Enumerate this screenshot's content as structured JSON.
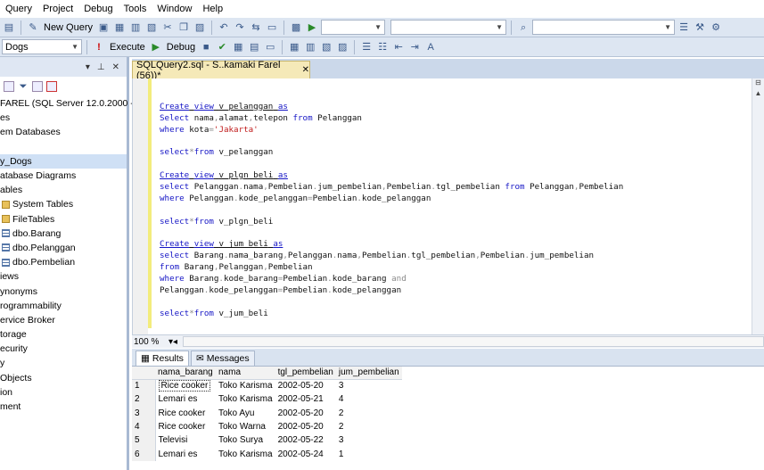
{
  "menu": [
    "Query",
    "Project",
    "Debug",
    "Tools",
    "Window",
    "Help"
  ],
  "toolbar1": {
    "new_query": "New Query"
  },
  "toolbar2": {
    "database": "Dogs",
    "execute": "Execute",
    "debug": "Debug"
  },
  "object_explorer": {
    "header_controls": [
      "▾",
      "📌",
      "✕"
    ],
    "items": [
      {
        "label": "FAREL (SQL Server 12.0.2000 -",
        "icon": "server-icon"
      },
      {
        "label": "es",
        "icon": ""
      },
      {
        "label": "em Databases",
        "icon": ""
      },
      {
        "label": "",
        "icon": ""
      },
      {
        "label": "y_Dogs",
        "icon": "",
        "selected": true
      },
      {
        "label": "atabase Diagrams",
        "icon": ""
      },
      {
        "label": "ables",
        "icon": ""
      },
      {
        "label": "System Tables",
        "icon": "folder-icon"
      },
      {
        "label": "FileTables",
        "icon": "folder-icon"
      },
      {
        "label": "dbo.Barang",
        "icon": "table-icon"
      },
      {
        "label": "dbo.Pelanggan",
        "icon": "table-icon"
      },
      {
        "label": "dbo.Pembelian",
        "icon": "table-icon"
      },
      {
        "label": "iews",
        "icon": ""
      },
      {
        "label": "ynonyms",
        "icon": ""
      },
      {
        "label": "rogrammability",
        "icon": ""
      },
      {
        "label": "ervice Broker",
        "icon": ""
      },
      {
        "label": "torage",
        "icon": ""
      },
      {
        "label": "ecurity",
        "icon": ""
      },
      {
        "label": "y",
        "icon": ""
      },
      {
        "label": "Objects",
        "icon": ""
      },
      {
        "label": "ion",
        "icon": ""
      },
      {
        "label": "ment",
        "icon": ""
      }
    ]
  },
  "tab": {
    "title": "SQLQuery2.sql - S..kamaki Farel (56))*",
    "close": "✕"
  },
  "code_lines": [
    "",
    "",
    "Create view v_pelanggan as",
    "Select nama,alamat,telepon from Pelanggan",
    "where kota='Jakarta'",
    "",
    "select*from v_pelanggan",
    "",
    "Create view v_plgn_beli as",
    "select Pelanggan.nama,Pembelian.jum_pembelian,Pembelian.tgl_pembelian from Pelanggan,Pembelian",
    "where Pelanggan.kode_pelanggan=Pembelian.kode_pelanggan",
    "",
    "select*from v_plgn_beli",
    "",
    "Create view v_jum_beli as",
    "select Barang.nama_barang,Pelanggan.nama,Pembelian.tgl_pembelian,Pembelian.jum_pembelian",
    "from Barang,Pelanggan,Pembelian",
    "where Barang.kode_barang=Pembelian.kode_barang and",
    "Pelanggan.kode_pelanggan=Pembelian.kode_pelanggan",
    "",
    "select*from v_jum_beli"
  ],
  "zoom": "100 %",
  "results_tabs": {
    "results": "Results",
    "messages": "Messages"
  },
  "results": {
    "columns": [
      "nama_barang",
      "nama",
      "tgl_pembelian",
      "jum_pembelian"
    ],
    "rows": [
      [
        "1",
        "Rice cooker",
        "Toko Karisma",
        "2002-05-20",
        "3"
      ],
      [
        "2",
        "Lemari es",
        "Toko Karisma",
        "2002-05-21",
        "4"
      ],
      [
        "3",
        "Rice cooker",
        "Toko Ayu",
        "2002-05-20",
        "2"
      ],
      [
        "4",
        "Rice cooker",
        "Toko Warna",
        "2002-05-20",
        "2"
      ],
      [
        "5",
        "Televisi",
        "Toko Surya",
        "2002-05-22",
        "3"
      ],
      [
        "6",
        "Lemari es",
        "Toko Karisma",
        "2002-05-24",
        "1"
      ]
    ]
  }
}
